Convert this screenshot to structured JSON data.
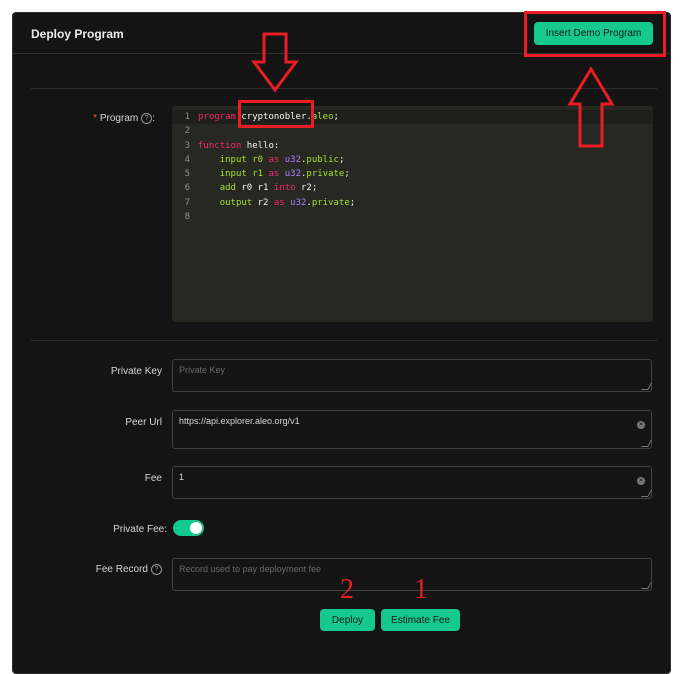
{
  "card": {
    "title": "Deploy Program"
  },
  "demo_button": {
    "label": "Insert Demo Program"
  },
  "form": {
    "program": {
      "label": "Program",
      "required_mark": "*",
      "colon": ":"
    },
    "private_key": {
      "label": "Private Key",
      "placeholder": "Private Key",
      "value": ""
    },
    "peer_url": {
      "label": "Peer Url",
      "value": "https://api.explorer.aleo.org/v1"
    },
    "fee": {
      "label": "Fee",
      "value": "1"
    },
    "private_fee": {
      "label": "Private Fee:",
      "checked": true
    },
    "fee_record": {
      "label": "Fee Record",
      "placeholder": "Record used to pay deployment fee",
      "value": ""
    }
  },
  "editor": {
    "lines": [
      {
        "num": "1",
        "tokens": [
          [
            "kw",
            "program"
          ],
          [
            "id",
            " "
          ],
          [
            "hl",
            "cryptonobler"
          ],
          [
            "id",
            "."
          ],
          [
            "kw2",
            "aleo"
          ],
          [
            "id",
            ";"
          ]
        ]
      },
      {
        "num": "2",
        "tokens": []
      },
      {
        "num": "3",
        "tokens": [
          [
            "kw",
            "function"
          ],
          [
            "id",
            " hello:"
          ]
        ]
      },
      {
        "num": "4",
        "tokens": [
          [
            "id",
            "    "
          ],
          [
            "kw2",
            "input"
          ],
          [
            "id",
            " "
          ],
          [
            "kw2",
            "r0"
          ],
          [
            "id",
            " "
          ],
          [
            "kw",
            "as"
          ],
          [
            "id",
            " "
          ],
          [
            "ty",
            "u32"
          ],
          [
            "id",
            "."
          ],
          [
            "kw2",
            "public"
          ],
          [
            "id",
            ";"
          ]
        ]
      },
      {
        "num": "5",
        "tokens": [
          [
            "id",
            "    "
          ],
          [
            "kw2",
            "input"
          ],
          [
            "id",
            " "
          ],
          [
            "kw2",
            "r1"
          ],
          [
            "id",
            " "
          ],
          [
            "kw",
            "as"
          ],
          [
            "id",
            " "
          ],
          [
            "ty",
            "u32"
          ],
          [
            "id",
            "."
          ],
          [
            "kw2",
            "private"
          ],
          [
            "id",
            ";"
          ]
        ]
      },
      {
        "num": "6",
        "tokens": [
          [
            "id",
            "    "
          ],
          [
            "kw2",
            "add"
          ],
          [
            "id",
            " r0 r1 "
          ],
          [
            "kw",
            "into"
          ],
          [
            "id",
            " r2;"
          ]
        ]
      },
      {
        "num": "7",
        "tokens": [
          [
            "id",
            "    "
          ],
          [
            "kw2",
            "output"
          ],
          [
            "id",
            " r2 "
          ],
          [
            "kw",
            "as"
          ],
          [
            "id",
            " "
          ],
          [
            "ty",
            "u32"
          ],
          [
            "id",
            "."
          ],
          [
            "kw2",
            "private"
          ],
          [
            "id",
            ";"
          ]
        ]
      },
      {
        "num": "8",
        "tokens": []
      }
    ]
  },
  "actions": {
    "deploy_label": "Deploy",
    "estimate_label": "Estimate Fee"
  },
  "annotations": {
    "step_deploy": "2",
    "step_estimate": "1"
  },
  "colors": {
    "accent": "#15c88d",
    "annotation": "#ea1c24",
    "background": "#141414"
  }
}
